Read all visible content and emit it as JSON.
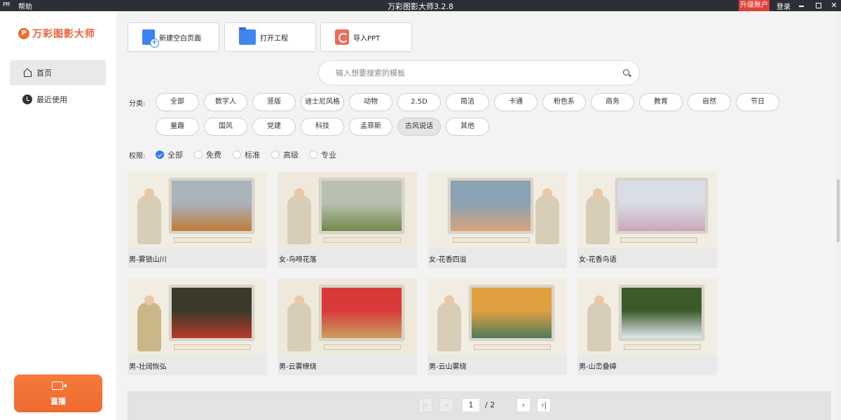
{
  "titlebar": {
    "pm": "PM",
    "help": "帮助",
    "title": "万彩图影大师3.2.8",
    "upgrade": "升级账户",
    "login": "登录",
    "close_glyph": "✕"
  },
  "sidebar": {
    "logo_mark": "P",
    "logo_name": "万彩图影大师",
    "nav": [
      {
        "label": "首页",
        "icon": "home-icon",
        "active": true
      },
      {
        "label": "最近使用",
        "icon": "clock-icon",
        "active": false
      }
    ],
    "live_label": "直播"
  },
  "actions": [
    {
      "label": "新建空白页面",
      "icon": "new-page-icon"
    },
    {
      "label": "打开工程",
      "icon": "folder-icon"
    },
    {
      "label": "导入PPT",
      "icon": "ppt-icon"
    }
  ],
  "search": {
    "placeholder": "输入想要搜索的模板",
    "icon": "search-icon"
  },
  "categories": {
    "label": "分类:",
    "items": [
      "全部",
      "数字人",
      "竖版",
      "迪士尼风格",
      "动物",
      "2.5D",
      "简洁",
      "卡通",
      "粉色系",
      "商务",
      "教育",
      "自然",
      "节日",
      "童趣",
      "国风",
      "党建",
      "科技",
      "孟菲斯",
      "古风说话",
      "其他"
    ],
    "selected": "古风说话"
  },
  "permissions": {
    "label": "权限:",
    "options": [
      "全部",
      "免费",
      "标准",
      "高级",
      "专业"
    ],
    "selected": "全部"
  },
  "templates": [
    {
      "title": "男-雾锁山川",
      "colors": [
        "#a9b3ba",
        "#c27b3a"
      ]
    },
    {
      "title": "女-鸟啼花落",
      "colors": [
        "#b9c0b0",
        "#6f8a4a"
      ]
    },
    {
      "title": "女-花香四溢",
      "colors": [
        "#8aa2b3",
        "#d9a37a"
      ]
    },
    {
      "title": "女-花香鸟语",
      "colors": [
        "#d9dde6",
        "#c9a6b8"
      ]
    },
    {
      "title": "男-壮阔恢弘",
      "colors": [
        "#3b3a2a",
        "#b83a2a"
      ]
    },
    {
      "title": "男-云雾缭绕",
      "colors": [
        "#d83a3a",
        "#caa060"
      ]
    },
    {
      "title": "男-云山雾绕",
      "colors": [
        "#e0a040",
        "#4f7a5a"
      ]
    },
    {
      "title": "男-山峦叠嶂",
      "colors": [
        "#3d5a2a",
        "#dfe7ee"
      ]
    }
  ],
  "pager": {
    "current": "1",
    "total": "/ 2",
    "first": "|‹",
    "prev": "‹",
    "next": "›",
    "last": "›|"
  }
}
